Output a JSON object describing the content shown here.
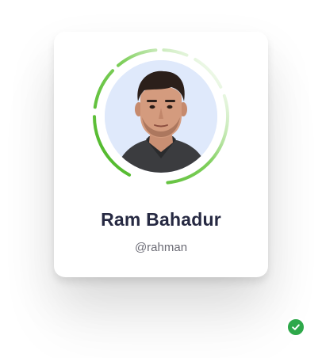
{
  "profile": {
    "name": "Ram Bahadur",
    "handle": "@rahman",
    "verified": true
  },
  "icons": {
    "badge": "check-icon",
    "avatar": "user-photo"
  },
  "colors": {
    "ring": "#5cbf3a",
    "badge": "#2ea84a",
    "avatar_bg": "#dfe9fb",
    "name": "#262942",
    "handle": "#6b6b75"
  }
}
